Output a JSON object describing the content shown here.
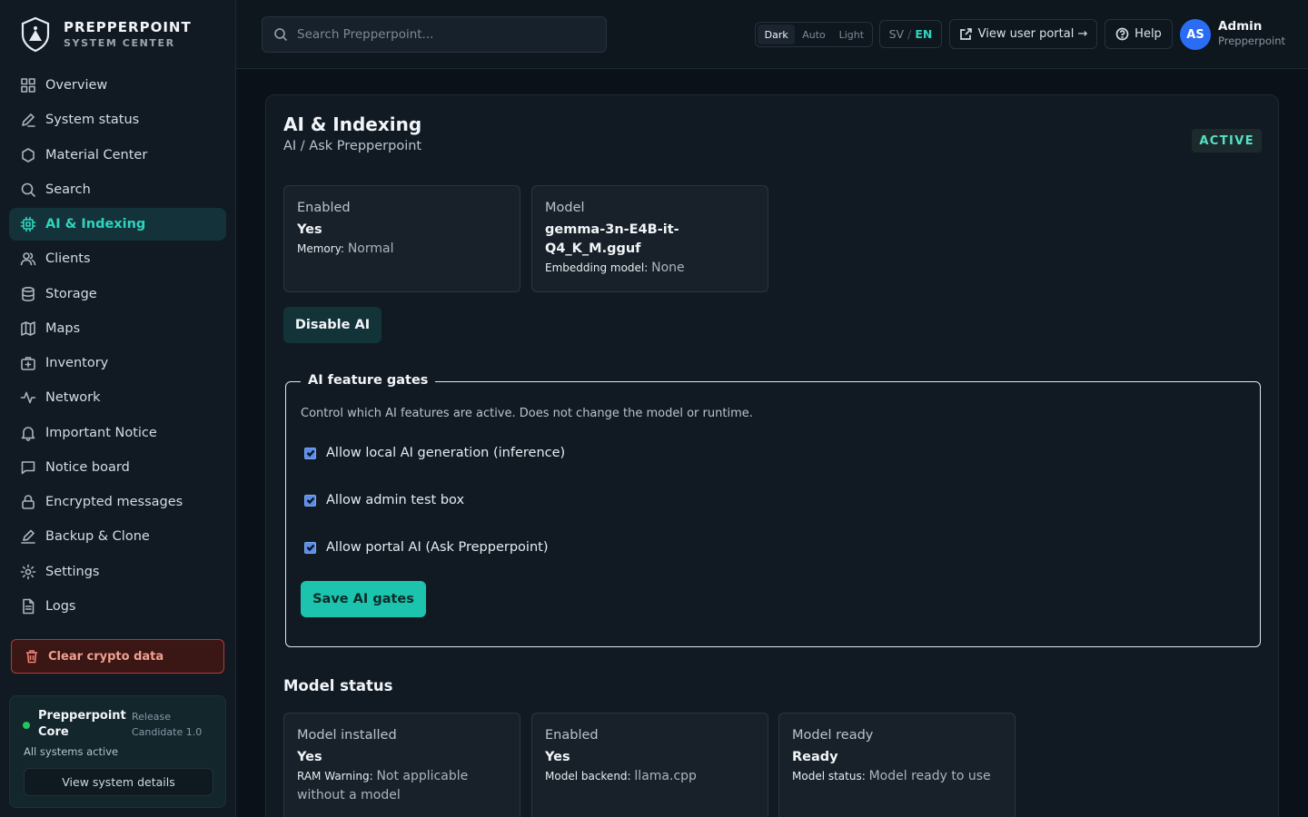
{
  "brand": {
    "title": "PREPPERPOINT",
    "subtitle": "SYSTEM CENTER"
  },
  "sidebar": {
    "items": [
      {
        "label": "Overview",
        "icon": "grid-icon"
      },
      {
        "label": "System status",
        "icon": "pen-icon"
      },
      {
        "label": "Material Center",
        "icon": "hexagon-icon"
      },
      {
        "label": "Search",
        "icon": "search-icon"
      },
      {
        "label": "AI & Indexing",
        "icon": "chip-icon",
        "active": true
      },
      {
        "label": "Clients",
        "icon": "users-icon"
      },
      {
        "label": "Storage",
        "icon": "database-icon"
      },
      {
        "label": "Maps",
        "icon": "map-icon"
      },
      {
        "label": "Inventory",
        "icon": "kit-icon"
      },
      {
        "label": "Network",
        "icon": "activity-icon"
      },
      {
        "label": "Important Notice",
        "icon": "bell-icon"
      },
      {
        "label": "Notice board",
        "icon": "message-icon"
      },
      {
        "label": "Encrypted messages",
        "icon": "lock-icon"
      },
      {
        "label": "Backup & Clone",
        "icon": "backup-icon"
      },
      {
        "label": "Settings",
        "icon": "gear-icon"
      },
      {
        "label": "Logs",
        "icon": "file-icon"
      }
    ],
    "danger_label": "Clear crypto data",
    "core": {
      "name": "Prepperpoint Core",
      "release": "Release Candidate 1.0",
      "status": "All systems active",
      "button": "View system details"
    }
  },
  "topbar": {
    "search_placeholder": "Search Prepperpoint...",
    "theme": {
      "options": [
        "Dark",
        "Auto",
        "Light"
      ],
      "selected": "Dark"
    },
    "lang": {
      "sv": "SV",
      "sep": "/",
      "en": "EN"
    },
    "portal_label": "View user portal →",
    "help_label": "Help",
    "user": {
      "initials": "AS",
      "name": "Admin",
      "org": "Prepperpoint"
    }
  },
  "main": {
    "title": "AI & Indexing",
    "subtitle": "AI / Ask Prepperpoint",
    "badge": "ACTIVE",
    "cards": [
      {
        "label": "Enabled",
        "value": "Yes",
        "meta_label": "Memory:",
        "meta_value": "Normal"
      },
      {
        "label": "Model",
        "value": "gemma-3n-E4B-it-Q4_K_M.gguf",
        "meta_label": "Embedding model:",
        "meta_value": "None"
      }
    ],
    "disable_label": "Disable AI",
    "gates": {
      "legend": "AI feature gates",
      "description": "Control which AI features are active. Does not change the model or runtime.",
      "options": [
        {
          "label": "Allow local AI generation (inference)",
          "checked": true
        },
        {
          "label": "Allow admin test box",
          "checked": true
        },
        {
          "label": "Allow portal AI (Ask Prepperpoint)",
          "checked": true
        }
      ],
      "save_label": "Save AI gates"
    },
    "model_status": {
      "title": "Model status",
      "cards": [
        {
          "label": "Model installed",
          "value": "Yes",
          "meta_label": "RAM Warning:",
          "meta_value": "Not applicable without a model"
        },
        {
          "label": "Enabled",
          "value": "Yes",
          "meta_label": "Model backend:",
          "meta_value": "llama.cpp"
        },
        {
          "label": "Model ready",
          "value": "Ready",
          "meta_label": "Model status:",
          "meta_value": "Model ready to use"
        }
      ]
    }
  },
  "colors": {
    "accent": "#2fd4bd",
    "danger": "#b33a2e",
    "avatar": "#2a6df4",
    "success": "#22c55e"
  }
}
